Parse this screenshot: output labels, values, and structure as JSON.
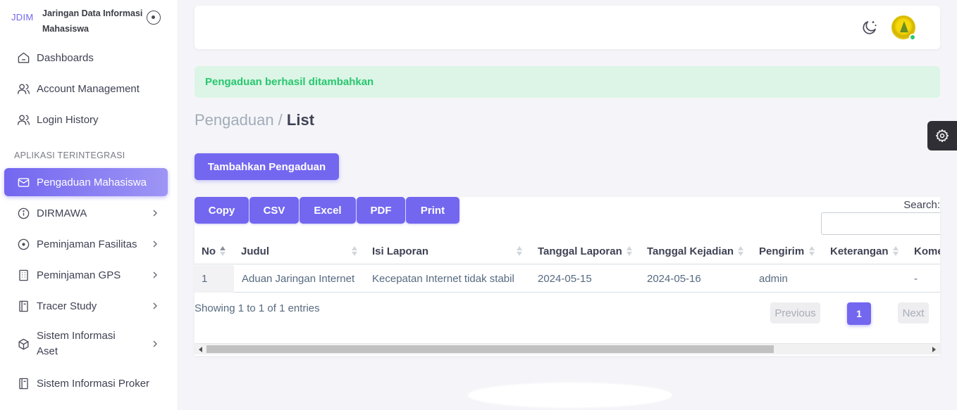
{
  "brand": {
    "logo_text": "JDIM",
    "name": "Jaringan Data Informasi Mahasiswa"
  },
  "sidebar": {
    "items_top": [
      {
        "label": "Dashboards",
        "icon": "home-icon"
      },
      {
        "label": "Account Management",
        "icon": "users-icon"
      },
      {
        "label": "Login History",
        "icon": "users-icon"
      }
    ],
    "section_header": "APLIKASI TERINTEGRASI",
    "items_apps": [
      {
        "label": "Pengaduan Mahasiswa",
        "icon": "mail-icon",
        "active": true
      },
      {
        "label": "DIRMAWA",
        "icon": "info-circle-icon",
        "has_children": true
      },
      {
        "label": "Peminjaman Fasilitas",
        "icon": "circle-dot-icon",
        "has_children": true
      },
      {
        "label": "Peminjaman GPS",
        "icon": "building-icon",
        "has_children": true
      },
      {
        "label": "Tracer Study",
        "icon": "book-icon",
        "has_children": true
      },
      {
        "label": "Sistem Informasi Aset",
        "icon": "box-icon",
        "has_children": true
      },
      {
        "label": "Sistem Informasi Proker",
        "icon": "book-icon"
      }
    ]
  },
  "topbar": {
    "theme_icon": "moon-icon",
    "avatar_icon": "university-logo-icon",
    "status_color": "#28c76f"
  },
  "alert": {
    "message": "Pengaduan berhasil ditambahkan"
  },
  "breadcrumb": {
    "parent": "Pengaduan /",
    "current": "List"
  },
  "actions": {
    "add_label": "Tambahkan Pengaduan"
  },
  "table": {
    "export_buttons": [
      "Copy",
      "CSV",
      "Excel",
      "PDF",
      "Print"
    ],
    "search_label": "Search:",
    "search_value": "",
    "columns": [
      "No",
      "Judul",
      "Isi Laporan",
      "Tanggal Laporan",
      "Tanggal Kejadian",
      "Pengirim",
      "Keterangan",
      "Kome"
    ],
    "rows": [
      [
        "1",
        "Aduan Jaringan Internet",
        "Kecepatan Internet tidak stabil",
        "2024-05-15",
        "2024-05-16",
        "admin",
        "",
        "-"
      ]
    ],
    "info": "Showing 1 to 1 of 1 entries",
    "pagination": {
      "previous": "Previous",
      "current_page": "1",
      "next": "Next"
    }
  },
  "colors": {
    "accent": "#7367f0",
    "success": "#28c76f",
    "alert_bg": "#dcf5e6"
  }
}
